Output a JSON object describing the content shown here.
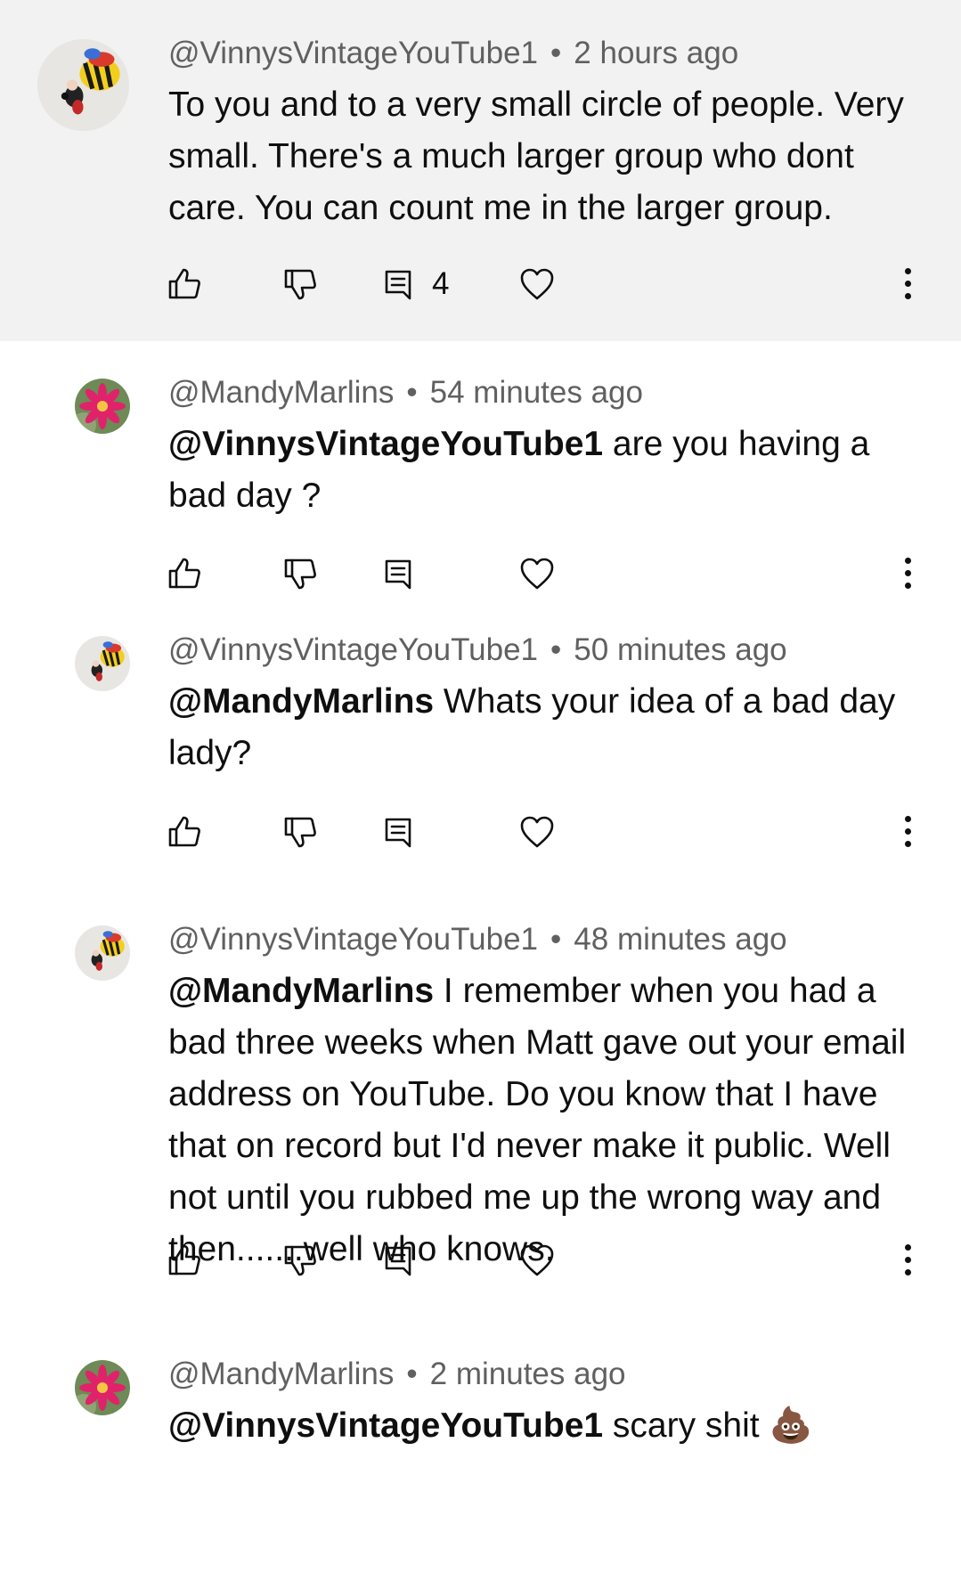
{
  "comments": [
    {
      "author": "@VinnysVintageYouTube1",
      "time": "2 hours ago",
      "mention": "",
      "text": "To you and to a very small circle of people. Very small. There's a much larger group who dont care. You can count me in the larger group.",
      "reply_count": "4",
      "avatar": "bee-plush-avatar",
      "highlighted": true
    },
    {
      "author": "@MandyMarlins",
      "time": "54 minutes ago",
      "mention": "@VinnysVintageYouTube1",
      "text": " are you having a bad day ?",
      "reply_count": "",
      "avatar": "pink-flower-avatar"
    },
    {
      "author": "@VinnysVintageYouTube1",
      "time": "50 minutes ago",
      "mention": "@MandyMarlins",
      "text": " Whats your idea of a bad day lady?",
      "reply_count": "",
      "avatar": "bee-plush-avatar"
    },
    {
      "author": "@VinnysVintageYouTube1",
      "time": "48 minutes ago",
      "mention": "@MandyMarlins",
      "text": " I remember when you had a bad three weeks when Matt gave out your email address on YouTube. Do you know that I have that on record but I'd never make it public. Well not until you rubbed me up the wrong way and then.......well who knows.",
      "reply_count": "",
      "avatar": "bee-plush-avatar"
    },
    {
      "author": "@MandyMarlins",
      "time": "2 minutes ago",
      "mention": "@VinnysVintageYouTube1",
      "text": " scary shit ",
      "emoji": "💩",
      "reply_count": "",
      "avatar": "pink-flower-avatar"
    }
  ],
  "separator": "•",
  "icons": {
    "like": "thumbs-up-icon",
    "dislike": "thumbs-down-icon",
    "reply": "comment-icon",
    "heart": "heart-icon",
    "more": "more-vert-icon"
  },
  "colors": {
    "highlight_bg": "#f2f2f2",
    "meta_text": "#606060",
    "text": "#0f0f0f"
  }
}
